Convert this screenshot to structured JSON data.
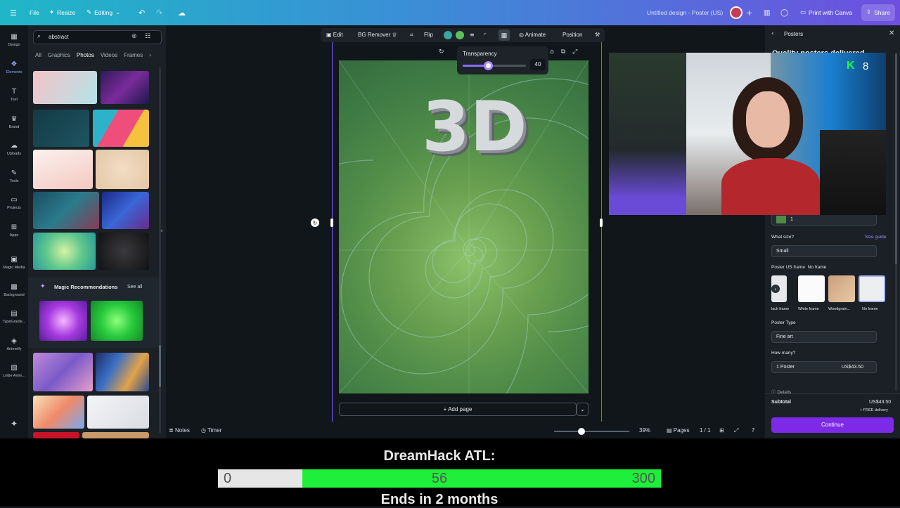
{
  "topbar": {
    "file_label": "File",
    "resize_label": "Resize",
    "editing_label": "Editing",
    "doc_title": "Untitled design - Poster (US)",
    "print_label": "Print with Canva",
    "share_label": "Share",
    "icons": [
      "menu-icon",
      "undo-icon",
      "redo-icon",
      "cloud-save-icon",
      "plus-icon",
      "analytics-icon",
      "comment-icon"
    ]
  },
  "leftrail": {
    "items": [
      {
        "label": "Design",
        "icon": "design-icon"
      },
      {
        "label": "Elements",
        "icon": "elements-icon"
      },
      {
        "label": "Text",
        "icon": "text-icon"
      },
      {
        "label": "Brand",
        "icon": "brand-icon"
      },
      {
        "label": "Uploads",
        "icon": "uploads-icon"
      },
      {
        "label": "Tools",
        "icon": "tools-icon"
      },
      {
        "label": "Projects",
        "icon": "projects-icon"
      },
      {
        "label": "Apps",
        "icon": "apps-icon"
      },
      {
        "label": "Magic Media",
        "icon": "magic-media-icon"
      },
      {
        "label": "Background",
        "icon": "background-icon"
      },
      {
        "label": "TypeGradie...",
        "icon": "typegradient-icon"
      },
      {
        "label": "Animeify",
        "icon": "animeify-icon"
      },
      {
        "label": "Lottie Anim...",
        "icon": "lottie-icon"
      }
    ]
  },
  "panel": {
    "search_value": "abstract",
    "tabs": [
      "All",
      "Graphics",
      "Photos",
      "Videos",
      "Frames"
    ],
    "active_tab": "Photos",
    "magic_title": "Magic Recommendations",
    "see_all": "See all"
  },
  "toolbar": {
    "edit": "Edit",
    "bg_remover": "BG Remover",
    "flip": "Flip",
    "animate": "Animate",
    "position": "Position",
    "swatch_colors": [
      "#3aa6a0",
      "#5cc05a"
    ]
  },
  "transparency": {
    "label": "Transparency",
    "value": "40",
    "fraction": 0.4
  },
  "canvas": {
    "add_page": "+ Add page",
    "poster_text": "3D"
  },
  "bottombar": {
    "notes": "Notes",
    "timer": "Timer",
    "zoom": "39%",
    "pages_label": "Pages",
    "page_count": "1 / 1"
  },
  "rightpanel": {
    "title": "Posters",
    "quality_text": "Quality posters delivered",
    "qty_swatch": "1",
    "size_label": "What size?",
    "size_guide": "Size guide",
    "size_value": "Small",
    "frame_label": "Poster US frame",
    "frame_value": "No frame",
    "frames": [
      "lack frame",
      "White frame",
      "Woodgrain...",
      "No frame"
    ],
    "type_label": "Poster Type",
    "type_value": "Fine art",
    "howmany_label": "How many?",
    "howmany_value": "1 Poster",
    "howmany_price": "US$43.50",
    "details": "Details",
    "subtotal_label": "Subtotal",
    "subtotal_value": "US$43.50",
    "delivery": "+ FREE delivery",
    "continue": "Continue"
  },
  "webcam": {
    "badge": "8"
  },
  "overlay": {
    "title": "DreamHack ATL:",
    "min": "0",
    "current": "56",
    "max": "300",
    "progress_start": 0.19,
    "subtitle": "Ends in 2 months",
    "fill_color": "#1eef3a"
  }
}
